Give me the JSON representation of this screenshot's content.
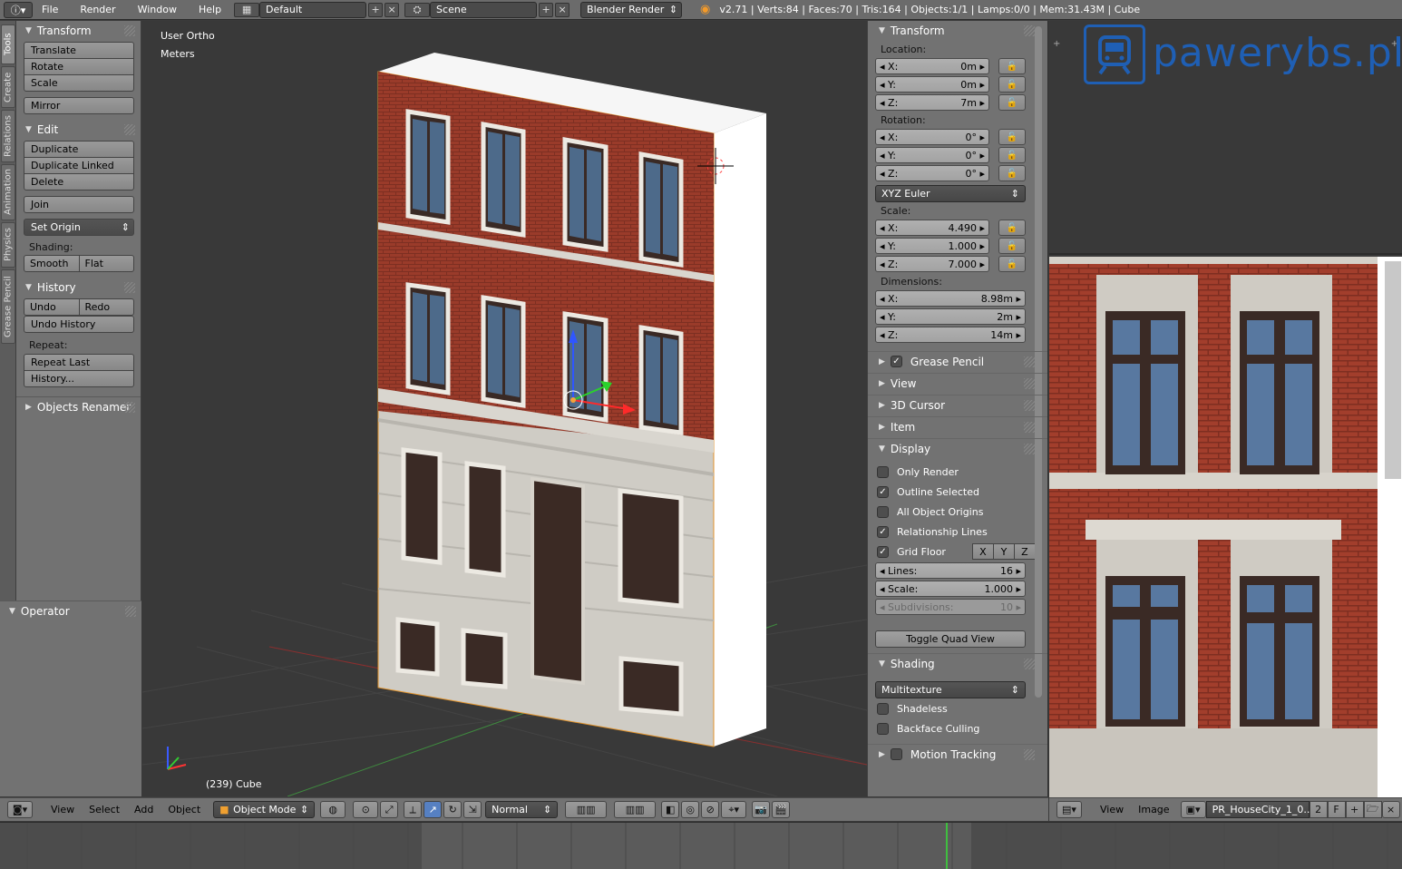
{
  "topbar": {
    "menus": [
      "File",
      "Render",
      "Window",
      "Help"
    ],
    "screen_layout": "Default",
    "scene": "Scene",
    "render_engine": "Blender Render",
    "status": "v2.71 | Verts:84 | Faces:70 | Tris:164 | Objects:1/1 | Lamps:0/0 | Mem:31.43M | Cube"
  },
  "tabs": [
    "Tools",
    "Create",
    "Relations",
    "Animation",
    "Physics",
    "Grease Pencil"
  ],
  "toolshelf": {
    "transform_header": "Transform",
    "translate": "Translate",
    "rotate": "Rotate",
    "scale": "Scale",
    "mirror": "Mirror",
    "edit_header": "Edit",
    "duplicate": "Duplicate",
    "duplicate_linked": "Duplicate Linked",
    "delete": "Delete",
    "join": "Join",
    "set_origin": "Set Origin",
    "shading_label": "Shading:",
    "smooth": "Smooth",
    "flat": "Flat",
    "history_header": "History",
    "undo": "Undo",
    "redo": "Redo",
    "undo_history": "Undo History",
    "repeat_label": "Repeat:",
    "repeat_last": "Repeat Last",
    "history_btn": "History...",
    "objects_renamer": "Objects Renamer",
    "operator_header": "Operator"
  },
  "viewport": {
    "view_name": "User Ortho",
    "units": "Meters",
    "object_info": "(239) Cube"
  },
  "npanel": {
    "transform_header": "Transform",
    "location_label": "Location:",
    "location": [
      {
        "axis": "X:",
        "value": "0m"
      },
      {
        "axis": "Y:",
        "value": "0m"
      },
      {
        "axis": "Z:",
        "value": "7m"
      }
    ],
    "rotation_label": "Rotation:",
    "rotation": [
      {
        "axis": "X:",
        "value": "0°"
      },
      {
        "axis": "Y:",
        "value": "0°"
      },
      {
        "axis": "Z:",
        "value": "0°"
      }
    ],
    "rotation_mode": "XYZ Euler",
    "scale_label": "Scale:",
    "scale": [
      {
        "axis": "X:",
        "value": "4.490"
      },
      {
        "axis": "Y:",
        "value": "1.000"
      },
      {
        "axis": "Z:",
        "value": "7.000"
      }
    ],
    "dimensions_label": "Dimensions:",
    "dimensions": [
      {
        "axis": "X:",
        "value": "8.98m"
      },
      {
        "axis": "Y:",
        "value": "2m"
      },
      {
        "axis": "Z:",
        "value": "14m"
      }
    ],
    "grease_pencil": "Grease Pencil",
    "view": "View",
    "cursor_3d": "3D Cursor",
    "item": "Item",
    "display_header": "Display",
    "only_render": "Only Render",
    "outline_selected": "Outline Selected",
    "all_object_origins": "All Object Origins",
    "relationship_lines": "Relationship Lines",
    "grid_floor": "Grid Floor",
    "axis_x": "X",
    "axis_y": "Y",
    "axis_z": "Z",
    "lines_label": "Lines:",
    "lines_value": "16",
    "scale_label2": "Scale:",
    "scale_value": "1.000",
    "subdivisions_label": "Subdivisions:",
    "subdivisions_value": "10",
    "toggle_quad_view": "Toggle Quad View",
    "shading_header": "Shading",
    "shading_mode": "Multitexture",
    "shadeless": "Shadeless",
    "backface_culling": "Backface Culling",
    "motion_tracking": "Motion Tracking"
  },
  "watermark": "pawerybs.pl",
  "vp_header": {
    "view": "View",
    "select": "Select",
    "add": "Add",
    "object": "Object",
    "mode": "Object Mode",
    "orientation": "Normal"
  },
  "ie_header": {
    "view": "View",
    "image": "Image",
    "image_name": "PR_HouseCity_1_0...",
    "users": "2",
    "fake": "F"
  },
  "colors": {
    "accent_blue": "#1f5fb4",
    "brick": "#9a3b2a",
    "stone": "#c9c6bf",
    "timeline_cursor": "#3fbf3f"
  }
}
